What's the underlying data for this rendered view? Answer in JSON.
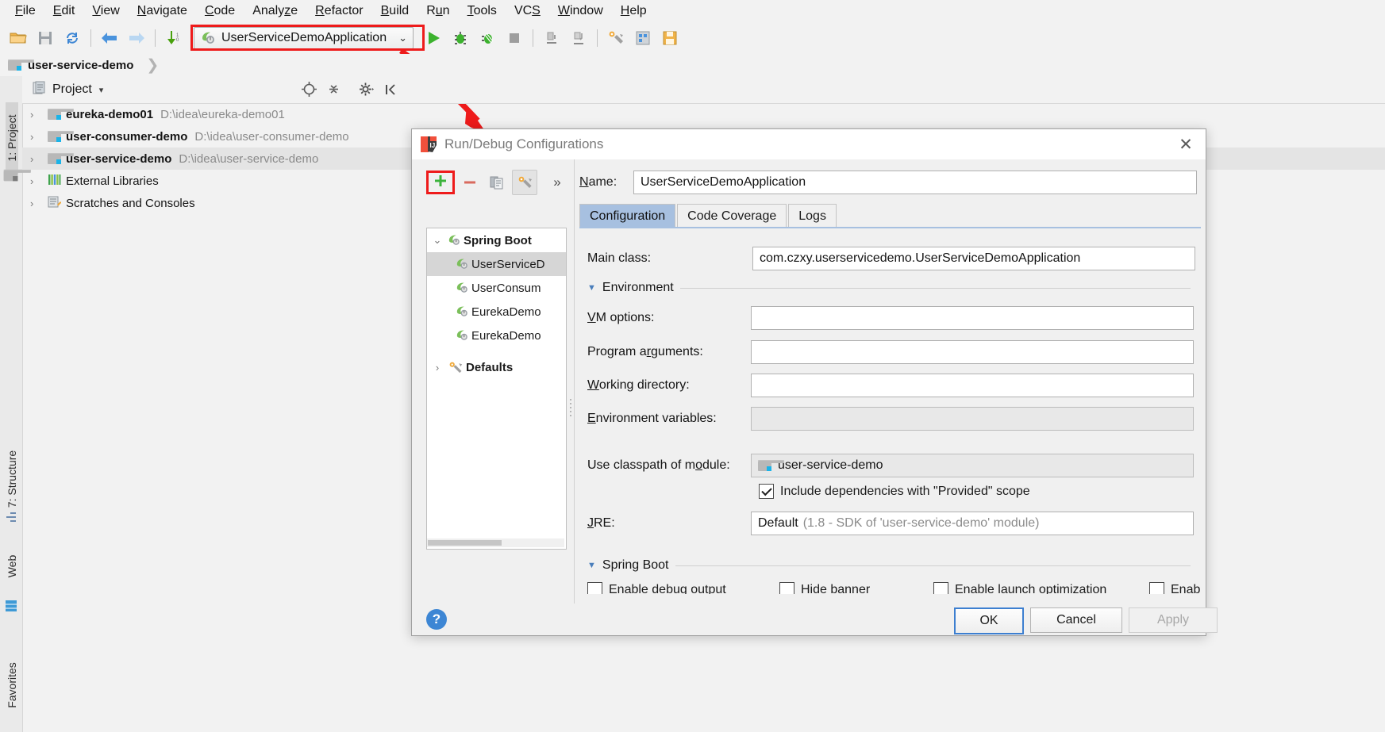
{
  "menu": {
    "items": [
      "File",
      "Edit",
      "View",
      "Navigate",
      "Code",
      "Analyze",
      "Refactor",
      "Build",
      "Run",
      "Tools",
      "VCS",
      "Window",
      "Help"
    ]
  },
  "toolbar": {
    "run_config_name": "UserServiceDemoApplication",
    "caret": "⌄",
    "icons": [
      "open-folder-icon",
      "save-all-icon",
      "sync-icon",
      "back-icon",
      "forward-icon",
      "update-project-icon",
      "run-icon",
      "debug-icon",
      "coverage-icon",
      "stop-icon",
      "profile-icon",
      "attach-icon",
      "settings-icon",
      "project-structure-icon",
      "save-icon"
    ]
  },
  "breadcrumb": {
    "project": "user-service-demo",
    "separator": "❯"
  },
  "stripe": {
    "project": "1: Project",
    "structure": "7: Structure",
    "web": "Web",
    "favorites": "Favorites"
  },
  "project_panel": {
    "title": "Project",
    "caret": "▾",
    "header_icons": [
      "locate-icon",
      "collapse-all-icon",
      "gear-icon",
      "hide-icon"
    ],
    "rows": [
      {
        "arrow": "›",
        "name": "eureka-demo01",
        "path": "D:\\idea\\eureka-demo01",
        "icon": "module-folder-icon",
        "selected": false
      },
      {
        "arrow": "›",
        "name": "user-consumer-demo",
        "path": "D:\\idea\\user-consumer-demo",
        "icon": "module-folder-icon",
        "selected": false
      },
      {
        "arrow": "›",
        "name": "user-service-demo",
        "path": "D:\\idea\\user-service-demo",
        "icon": "module-folder-icon",
        "selected": true
      },
      {
        "arrow": "›",
        "name": "External Libraries",
        "path": "",
        "icon": "libraries-icon",
        "selected": false
      },
      {
        "arrow": "›",
        "name": "Scratches and Consoles",
        "path": "",
        "icon": "scratches-icon",
        "selected": false
      }
    ]
  },
  "dialog": {
    "title": "Run/Debug Configurations",
    "close": "✕",
    "toolbar": {
      "add": "+",
      "remove": "−",
      "copy": "copy-icon",
      "edit_defaults": "wrench-icon",
      "more": "»"
    },
    "tree": [
      {
        "arrow": "⌄",
        "label": "Spring Boot",
        "bold": true,
        "indent": false,
        "icon": "spring-boot-icon",
        "selected": false
      },
      {
        "arrow": "",
        "label": "UserServiceD",
        "bold": false,
        "indent": true,
        "icon": "spring-boot-icon",
        "selected": true
      },
      {
        "arrow": "",
        "label": "UserConsum",
        "bold": false,
        "indent": true,
        "icon": "spring-boot-icon",
        "selected": false
      },
      {
        "arrow": "",
        "label": "EurekaDemo",
        "bold": false,
        "indent": true,
        "icon": "spring-boot-icon",
        "selected": false
      },
      {
        "arrow": "",
        "label": "EurekaDemo",
        "bold": false,
        "indent": true,
        "icon": "spring-boot-icon",
        "selected": false
      },
      {
        "arrow": "›",
        "label": "Defaults",
        "bold": true,
        "indent": false,
        "icon": "wrench-icon",
        "selected": false
      }
    ],
    "name_label": "Name:",
    "name_value": "UserServiceDemoApplication",
    "tabs": [
      {
        "label": "Configuration",
        "active": true
      },
      {
        "label": "Code Coverage",
        "active": false
      },
      {
        "label": "Logs",
        "active": false
      }
    ],
    "fields": {
      "main_class_label": "Main class:",
      "main_class_value": "com.czxy.userservicedemo.UserServiceDemoApplication",
      "environment_section": "Environment",
      "vm_options_label": "VM options:",
      "vm_options_value": "",
      "program_arguments_label": "Program arguments:",
      "program_arguments_value": "",
      "working_directory_label": "Working directory:",
      "working_directory_value": "",
      "environment_variables_label": "Environment variables:",
      "environment_variables_value": "",
      "classpath_label": "Use classpath of module:",
      "classpath_value": "user-service-demo",
      "include_provided_label": "Include dependencies with \"Provided\" scope",
      "include_provided_checked": true,
      "jre_label": "JRE:",
      "jre_value": "Default",
      "jre_hint": "(1.8 - SDK of 'user-service-demo' module)",
      "springboot_section": "Spring Boot",
      "enable_debug_output_label": "Enable debug output",
      "hide_banner_label": "Hide banner",
      "enable_launch_optimization_label": "Enable launch optimization",
      "enable_trailing_label": "Enab"
    },
    "footer": {
      "help": "?",
      "ok": "OK",
      "cancel": "Cancel",
      "apply": "Apply"
    }
  },
  "annotation": {
    "color": "#ee1b1b"
  }
}
